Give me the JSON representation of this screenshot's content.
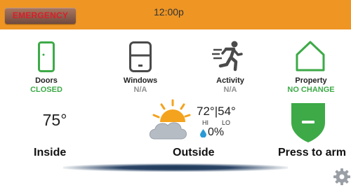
{
  "header": {
    "emergency_label": "EMERGENCY",
    "time": "12:00p"
  },
  "status_tiles": [
    {
      "label": "Doors",
      "value": "CLOSED",
      "icon": "door-icon",
      "value_color": "#3daa47"
    },
    {
      "label": "Windows",
      "value": "N/A",
      "icon": "window-icon",
      "value_color": "#909090"
    },
    {
      "label": "Activity",
      "value": "N/A",
      "icon": "running-person-icon",
      "value_color": "#909090"
    },
    {
      "label": "Property",
      "value": "NO CHANGE",
      "icon": "house-icon",
      "value_color": "#3daa47"
    }
  ],
  "inside": {
    "temperature": "75°",
    "label": "Inside"
  },
  "outside": {
    "high_low": "72°|54°",
    "hi_label": "HI",
    "lo_label": "LO",
    "precip": "0%",
    "label": "Outside",
    "weather_icon": "partly-cloudy-icon"
  },
  "arm": {
    "label": "Press to arm",
    "icon": "shield-icon",
    "color": "#3daa47"
  },
  "settings_icon": "gear-icon",
  "colors": {
    "header": "#ee9524",
    "emergency_text": "#d8202a",
    "accent_green": "#3daa47"
  }
}
